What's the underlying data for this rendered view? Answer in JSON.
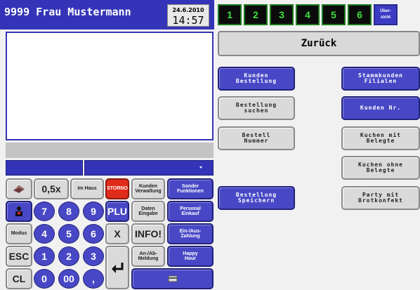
{
  "header": {
    "name": "9999 Frau Mustermann",
    "date": "24.6.2010",
    "time": "14:57"
  },
  "tabs": [
    "1",
    "2",
    "3",
    "4",
    "5",
    "6"
  ],
  "overview_tab": "Über-\nsicht",
  "back_button": "Zurück",
  "action_buttons": {
    "kunden_bestellung": "Kunden\nBestellung",
    "bestellung_suchen": "Bestellung\nsuchen",
    "bestell_nummer": "Bestell\nNummer",
    "bestellung_speichern": "Bestellung\nSpeichern",
    "stammkunden_filialen": "Stammkunden\nFilialen",
    "kunden_nr": "Kunden Nr.",
    "kuchen_mit_belegte": "Kuchen mit\nBelegte",
    "kuchen_ohne_belegte": "Kuchen ohne\nBelegte",
    "party_mit_brotkonfekt": "Party mit\nBrotkonfekt"
  },
  "keypad": {
    "half": "0,5x",
    "im_haus": "Im Haus",
    "storno": "STORNO",
    "kunden_verwaltung": "Kunden\nVerwaltung",
    "sonder_funktionen": "Sonder\nFunktionen",
    "plu": "PLU",
    "daten_eingabe": "Daten\nEingabe",
    "personal_einkauf": "Personal\nEinkauf",
    "modus": "Modus",
    "x": "X",
    "info": "INFO!",
    "ein_aus_zahlung": "Ein-/Aus-\nZahlung",
    "esc": "ESC",
    "an_ab_meldung": "An-/Ab-\nMeldung",
    "happy_hour": "Happy\nHour",
    "cl": "CL",
    "digits": {
      "7": "7",
      "8": "8",
      "9": "9",
      "4": "4",
      "5": "5",
      "6": "6",
      "1": "1",
      "2": "2",
      "3": "3",
      "0": "0",
      "00": "00",
      "dot": ","
    }
  },
  "colors": {
    "accent_blue": "#3434b8",
    "tab_green": "#3de03d",
    "storno_red": "#e12b1a"
  }
}
